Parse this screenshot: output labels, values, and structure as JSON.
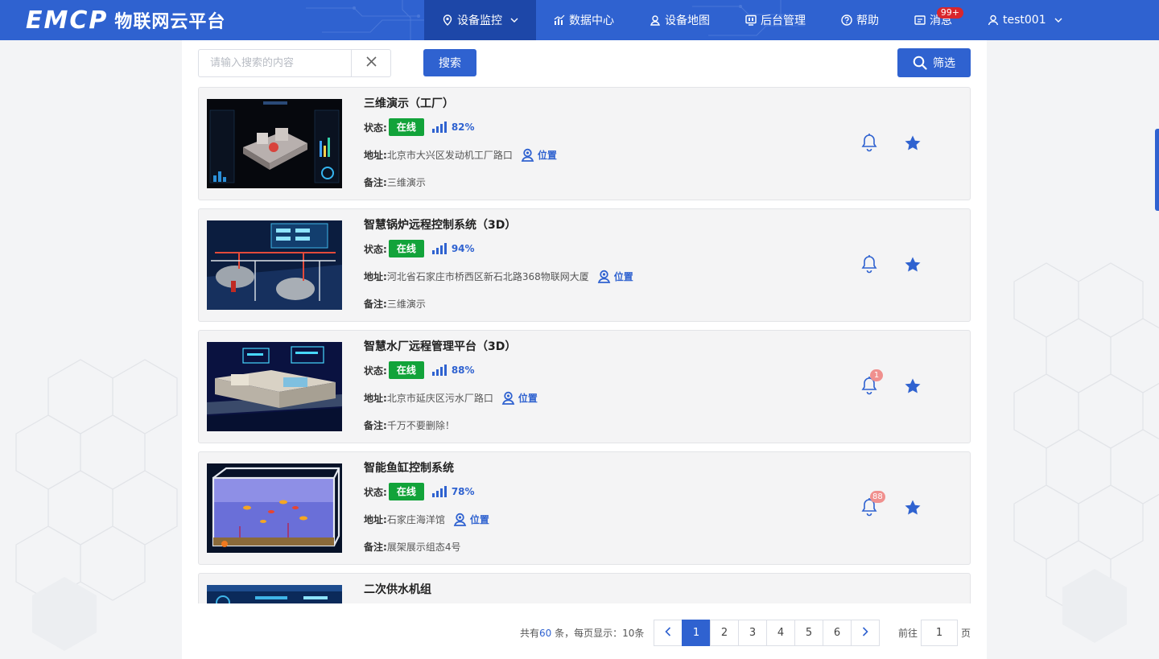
{
  "header": {
    "logo_text": "EMCP",
    "platform_name": "物联网云平台",
    "nav": [
      {
        "label": "设备监控",
        "icon": "map-pin-icon",
        "active": true,
        "has_dropdown": true
      },
      {
        "label": "数据中心",
        "icon": "bar-chart-icon",
        "active": false
      },
      {
        "label": "设备地图",
        "icon": "location-person-icon",
        "active": false
      },
      {
        "label": "后台管理",
        "icon": "monitor-icon",
        "active": false
      },
      {
        "label": "帮助",
        "icon": "question-circle-icon",
        "active": false
      },
      {
        "label": "消息",
        "icon": "message-icon",
        "active": false,
        "badge": "99+"
      },
      {
        "label": "test001",
        "icon": "user-icon",
        "active": false,
        "has_dropdown": true
      }
    ]
  },
  "toolbar": {
    "search_placeholder": "请输入搜索的内容",
    "search_label": "搜索",
    "filter_label": "筛选"
  },
  "labels": {
    "status": "状态:",
    "address": "地址:",
    "note": "备注:",
    "location": "位置"
  },
  "devices": [
    {
      "title": "三维演示（工厂）",
      "status": "在线",
      "signal": "82%",
      "address": "北京市大兴区发动机工厂路口",
      "note": "三维演示",
      "alarm_count": "",
      "favorite": true,
      "thumb": "factory"
    },
    {
      "title": "智慧锅炉远程控制系统（3D）",
      "status": "在线",
      "signal": "94%",
      "address": "河北省石家庄市桥西区新石北路368物联网大厦",
      "note": "三维演示",
      "alarm_count": "",
      "favorite": true,
      "thumb": "boiler"
    },
    {
      "title": "智慧水厂远程管理平台（3D）",
      "status": "在线",
      "signal": "88%",
      "address": "北京市延庆区污水厂路口",
      "note": "千万不要删除！",
      "alarm_count": "1",
      "favorite": true,
      "thumb": "water"
    },
    {
      "title": "智能鱼缸控制系统",
      "status": "在线",
      "signal": "78%",
      "address": "石家庄海洋馆",
      "note": "展架展示组态4号",
      "alarm_count": "88",
      "favorite": true,
      "thumb": "aquarium"
    },
    {
      "title": "二次供水机组",
      "status": "",
      "signal": "",
      "address": "",
      "note": "",
      "alarm_count": "",
      "favorite": false,
      "thumb": "pump"
    }
  ],
  "pagination": {
    "total_prefix": "共有",
    "total": "60",
    "total_suffix": " 条，每页显示：10条",
    "pages": [
      "1",
      "2",
      "3",
      "4",
      "5",
      "6"
    ],
    "current": "1",
    "goto_label": "前往",
    "goto_value": "1",
    "page_unit": "页"
  },
  "colors": {
    "primary": "#2f62d0",
    "online": "#12a33a",
    "badge_red": "#d9262c"
  }
}
